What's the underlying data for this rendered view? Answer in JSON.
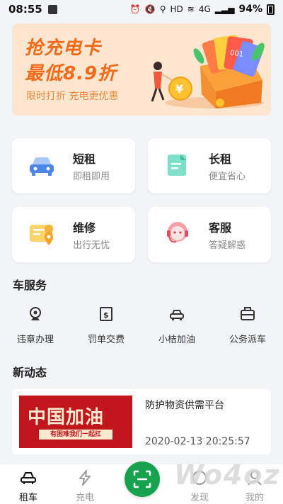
{
  "status_bar": {
    "time": "08:55",
    "network": "HD",
    "signal_label": "4G",
    "battery": "94%"
  },
  "banner": {
    "title_line1": "抢充电卡",
    "title_line2": "最低8.9折",
    "subtitle": "限时打折  充电更优惠",
    "card_text": "001",
    "coin_symbol": "¥",
    "colors": {
      "background": "#fde6cf",
      "accent": "#f36a1a"
    }
  },
  "cards": [
    {
      "title": "短租",
      "subtitle": "即租即用",
      "icon": "car-icon"
    },
    {
      "title": "长租",
      "subtitle": "便宜省心",
      "icon": "document-icon"
    },
    {
      "title": "维修",
      "subtitle": "出行无忧",
      "icon": "repair-location-icon"
    },
    {
      "title": "客服",
      "subtitle": "答疑解惑",
      "icon": "customer-service-icon"
    }
  ],
  "car_services": {
    "title": "车服务",
    "items": [
      {
        "label": "违章办理",
        "icon": "camera-icon"
      },
      {
        "label": "罚单交费",
        "icon": "receipt-icon"
      },
      {
        "label": "小桔加油",
        "icon": "car-front-icon"
      },
      {
        "label": "公务派车",
        "icon": "briefcase-icon"
      }
    ]
  },
  "news": {
    "title": "新动态",
    "items": [
      {
        "thumb_title": "中国加油",
        "thumb_caption": "有困难我们一起扛",
        "headline": "防护物资供需平台",
        "time": "2020-02-13 20:25:57"
      }
    ]
  },
  "tabbar": {
    "tabs": [
      {
        "label": "租车",
        "icon": "car-outline-icon",
        "active": true
      },
      {
        "label": "充电",
        "icon": "lightning-icon",
        "active": false
      },
      {
        "label": "发现",
        "icon": "discover-icon",
        "active": false
      },
      {
        "label": "我的",
        "icon": "profile-icon",
        "active": false
      }
    ],
    "scan_icon": "scan-icon",
    "colors": {
      "active": "#111111",
      "inactive": "#9a9a9a",
      "scan": "#17a24d"
    }
  },
  "watermark": "Wo4oz"
}
